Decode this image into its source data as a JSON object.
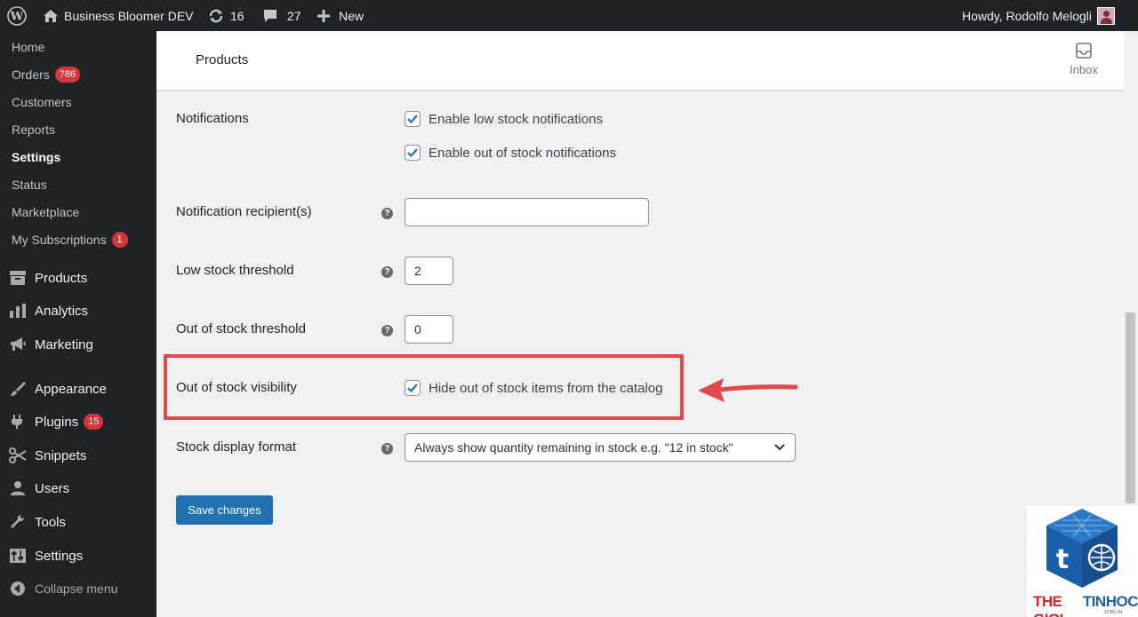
{
  "admin_bar": {
    "site_name": "Business Bloomer DEV",
    "updates_count": "16",
    "comments_count": "27",
    "new_label": "New",
    "greeting": "Howdy, Rodolfo Melogli"
  },
  "sidebar": {
    "submenu": [
      {
        "label": "Home"
      },
      {
        "label": "Orders",
        "badge": "786"
      },
      {
        "label": "Customers"
      },
      {
        "label": "Reports"
      },
      {
        "label": "Settings",
        "current": true
      },
      {
        "label": "Status"
      },
      {
        "label": "Marketplace"
      },
      {
        "label": "My Subscriptions",
        "badge": "1"
      }
    ],
    "menu": [
      {
        "label": "Products",
        "icon": "archive-icon"
      },
      {
        "label": "Analytics",
        "icon": "bar-chart-icon"
      },
      {
        "label": "Marketing",
        "icon": "megaphone-icon"
      },
      {
        "label": "Appearance",
        "icon": "paintbrush-icon"
      },
      {
        "label": "Plugins",
        "icon": "plug-icon",
        "badge": "15"
      },
      {
        "label": "Snippets",
        "icon": "scissors-icon"
      },
      {
        "label": "Users",
        "icon": "user-icon"
      },
      {
        "label": "Tools",
        "icon": "wrench-icon"
      },
      {
        "label": "Settings",
        "icon": "sliders-icon"
      }
    ],
    "collapse_label": "Collapse menu"
  },
  "header": {
    "title": "Products",
    "inbox_label": "Inbox"
  },
  "form": {
    "notifications": {
      "label": "Notifications",
      "low_stock": "Enable low stock notifications",
      "out_of_stock": "Enable out of stock notifications"
    },
    "recipient": {
      "label": "Notification recipient(s)",
      "value": ""
    },
    "low_threshold": {
      "label": "Low stock threshold",
      "value": "2"
    },
    "out_threshold": {
      "label": "Out of stock threshold",
      "value": "0"
    },
    "visibility": {
      "label": "Out of stock visibility",
      "checkbox": "Hide out of stock items from the catalog"
    },
    "display_format": {
      "label": "Stock display format",
      "selected": "Always show quantity remaining in stock e.g. \"12 in stock\""
    },
    "save_label": "Save changes"
  },
  "watermark": {
    "word1": "THE GIOI",
    "word2": "TINHOC",
    "domain": ".COM.VN"
  },
  "colors": {
    "admin_dark": "#1d2327",
    "accent_blue": "#2271b1",
    "badge_red": "#d63638",
    "annotation_red": "#e2474b"
  }
}
